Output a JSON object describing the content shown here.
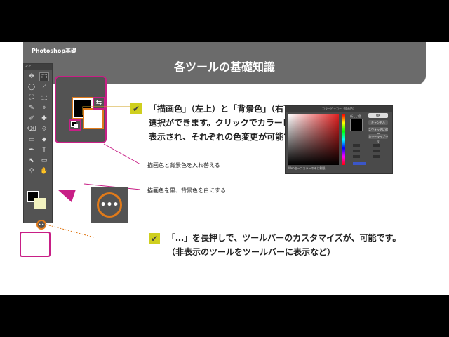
{
  "header": {
    "crumb": "Photoshop基礎",
    "title": "各ツールの基礎知識"
  },
  "toolbar": {
    "grip": "<<",
    "tools": [
      "✥",
      "⬚",
      "◯",
      "⟋",
      "⛶",
      "⬚",
      "✎",
      "⌖",
      "✐",
      "✚",
      "⌫",
      "⟐",
      "▭",
      "⬥",
      "✒",
      "T",
      "⬉",
      "▭",
      "✋",
      "⚲"
    ],
    "more": "•••"
  },
  "swatch_panel": {
    "swap_glyph": "⇆",
    "label_swap": "描画色と背景色を入れ替える",
    "label_reset": "描画色を黒、背景色を白にする"
  },
  "para1": {
    "line1": "「描画色」（左上）と「背景色」（右下）の",
    "line2": "選択ができます。クリックでカラーピッカーウィンドウが",
    "line3": "表示され、それぞれの色変更が可能です。"
  },
  "para2": {
    "line1": "「…」を長押しで、ツールバーのカスタマイズが、可能です。",
    "line2": "（非表示のツールをツールバーに表示など）"
  },
  "picker": {
    "title": "カラーピッカー（描画色）",
    "ok": "OK",
    "cancel": "キャンセル",
    "add_swatch": "スウォッチに追加",
    "libraries": "カラーライブラリ",
    "current": "新しい色",
    "web_only": "Webセーフカラーのみに制限"
  },
  "colors": {
    "accent_pink": "#c81f86",
    "accent_orange": "#e07a1a",
    "check_yellow": "#cfcf1e"
  }
}
